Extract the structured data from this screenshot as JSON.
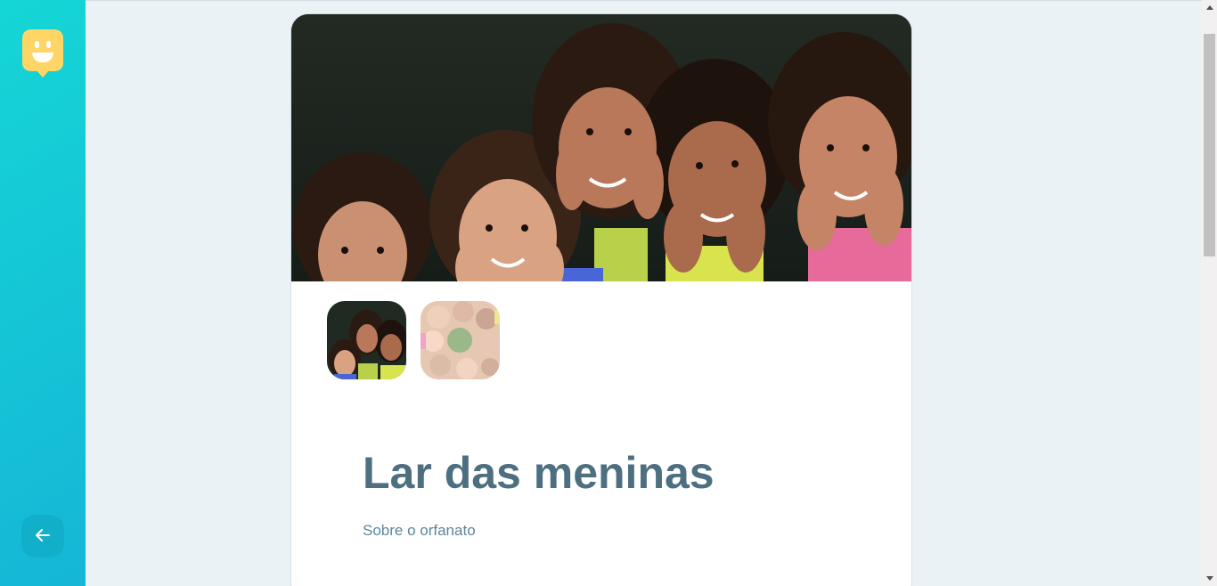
{
  "app": {
    "title": "Lar das meninas",
    "subtitle": "Sobre o orfanato"
  },
  "sidebar": {
    "logo_icon": "smiley-balloon-logo-icon",
    "back_icon": "arrow-left-icon"
  },
  "gallery": {
    "hero_image": "children-smiling-photo",
    "thumbnails": [
      {
        "name": "children-smiling-thumb",
        "active": true
      },
      {
        "name": "children-circle-thumb",
        "active": false
      }
    ]
  },
  "colors": {
    "sidebar_gradient_start": "#15d6d6",
    "sidebar_gradient_end": "#15b6d6",
    "logo_yellow": "#ffd666",
    "title": "#4d6f80",
    "subtitle": "#5c8599",
    "background": "#ebf2f5"
  }
}
